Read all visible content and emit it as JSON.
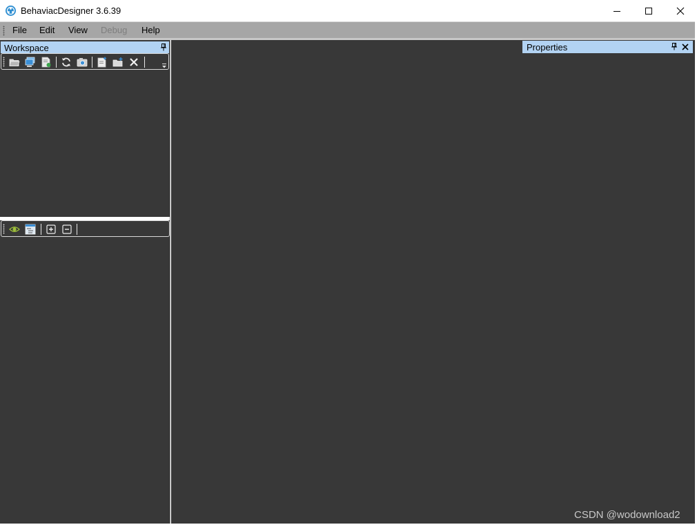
{
  "window": {
    "title": "BehaviacDesigner 3.6.39",
    "icon": "behaviac-app-icon"
  },
  "menu": {
    "items": [
      {
        "label": "File",
        "enabled": true
      },
      {
        "label": "Edit",
        "enabled": true
      },
      {
        "label": "View",
        "enabled": true
      },
      {
        "label": "Debug",
        "enabled": false
      },
      {
        "label": "Help",
        "enabled": true
      }
    ]
  },
  "workspace": {
    "title": "Workspace",
    "toolbar_icons": [
      "open-folder-icon",
      "computer-icon",
      "document-icon",
      "refresh-icon",
      "camera-icon",
      "new-file-icon",
      "new-folder-icon",
      "delete-icon"
    ],
    "tree_toolbar_icons": [
      "eye-icon",
      "tree-view-icon",
      "expand-all-icon",
      "collapse-all-icon"
    ]
  },
  "properties": {
    "title": "Properties"
  },
  "watermark": "CSDN @wodownload2",
  "colors": {
    "panel_bg": "#383838",
    "header_bg": "#b2d3f3",
    "menubar_bg": "#a6a6a6"
  }
}
